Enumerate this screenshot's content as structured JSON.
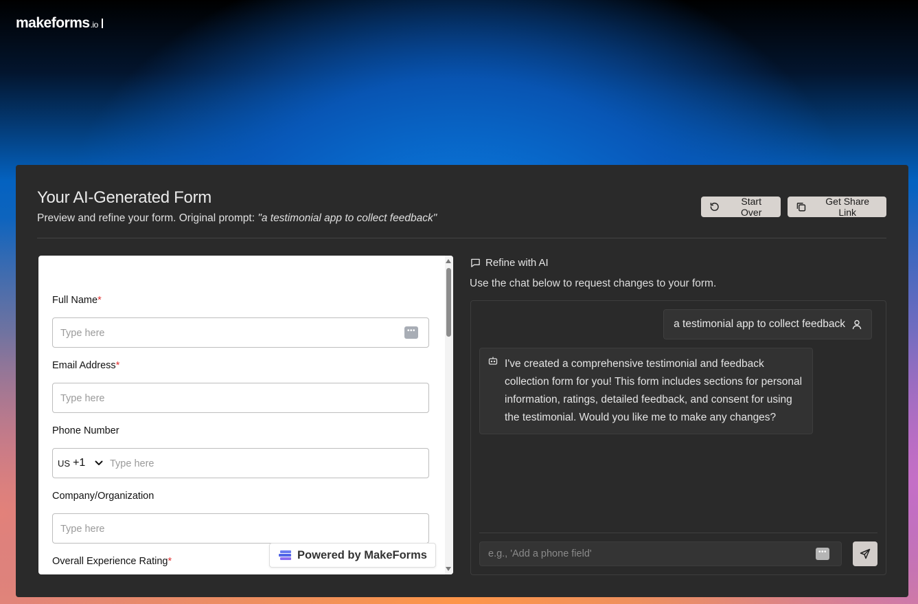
{
  "brand": {
    "name": "makeforms",
    "suffix": ".io"
  },
  "panel": {
    "title": "Your AI-Generated Form",
    "subtitle_prefix": "Preview and refine your form. Original prompt: ",
    "subtitle_prompt": "\"a testimonial app to collect feedback\"",
    "start_over_label": "Start Over",
    "share_label": "Get Share Link"
  },
  "form": {
    "fields": [
      {
        "label": "Full Name",
        "required": "*",
        "placeholder": "Type here"
      },
      {
        "label": "Email Address",
        "required": "*",
        "placeholder": "Type here"
      },
      {
        "label": "Phone Number",
        "required": "",
        "placeholder": "Type here",
        "country_code": "US",
        "dial_code": "+1"
      },
      {
        "label": "Company/Organization",
        "required": "",
        "placeholder": "Type here"
      },
      {
        "label": "Overall Experience Rating",
        "required": "*"
      }
    ],
    "powered_by": "Powered by MakeForms"
  },
  "refine": {
    "title": "Refine with AI",
    "subtitle": "Use the chat below to request changes to your form.",
    "messages": [
      {
        "role": "user",
        "text": "a testimonial app to collect feedback"
      },
      {
        "role": "assistant",
        "text": "I've created a comprehensive testimonial and feedback collection form for you! This form includes sections for personal information, ratings, detailed feedback, and consent for using the testimonial. Would you like me to make any changes?"
      }
    ],
    "input_placeholder": "e.g., 'Add a phone field'"
  }
}
